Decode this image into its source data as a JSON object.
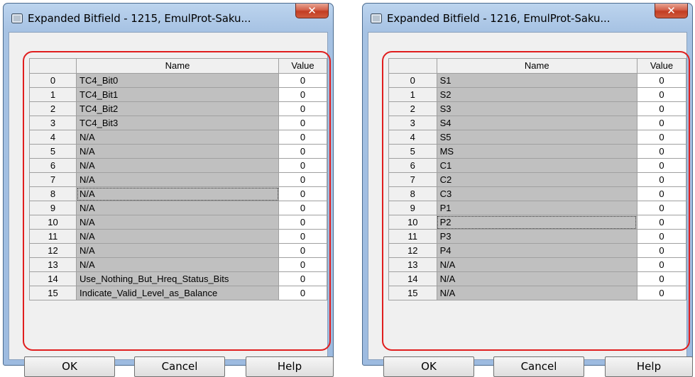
{
  "dialogs": [
    {
      "title": "Expanded Bitfield - 1215, EmulProt-Saku...",
      "columns": {
        "name": "Name",
        "value": "Value"
      },
      "rows": [
        {
          "idx": "0",
          "name": "TC4_Bit0",
          "value": "0"
        },
        {
          "idx": "1",
          "name": "TC4_Bit1",
          "value": "0"
        },
        {
          "idx": "2",
          "name": "TC4_Bit2",
          "value": "0"
        },
        {
          "idx": "3",
          "name": "TC4_Bit3",
          "value": "0"
        },
        {
          "idx": "4",
          "name": "N/A",
          "value": "0"
        },
        {
          "idx": "5",
          "name": "N/A",
          "value": "0"
        },
        {
          "idx": "6",
          "name": "N/A",
          "value": "0"
        },
        {
          "idx": "7",
          "name": "N/A",
          "value": "0"
        },
        {
          "idx": "8",
          "name": "N/A",
          "value": "0"
        },
        {
          "idx": "9",
          "name": "N/A",
          "value": "0"
        },
        {
          "idx": "10",
          "name": "N/A",
          "value": "0"
        },
        {
          "idx": "11",
          "name": "N/A",
          "value": "0"
        },
        {
          "idx": "12",
          "name": "N/A",
          "value": "0"
        },
        {
          "idx": "13",
          "name": "N/A",
          "value": "0"
        },
        {
          "idx": "14",
          "name": "Use_Nothing_But_Hreq_Status_Bits",
          "value": "0"
        },
        {
          "idx": "15",
          "name": "Indicate_Valid_Level_as_Balance",
          "value": "0"
        }
      ],
      "focused_row": 8,
      "buttons": {
        "ok": "OK",
        "cancel": "Cancel",
        "help": "Help"
      }
    },
    {
      "title": "Expanded Bitfield - 1216, EmulProt-Saku...",
      "columns": {
        "name": "Name",
        "value": "Value"
      },
      "rows": [
        {
          "idx": "0",
          "name": "S1",
          "value": "0"
        },
        {
          "idx": "1",
          "name": "S2",
          "value": "0"
        },
        {
          "idx": "2",
          "name": "S3",
          "value": "0"
        },
        {
          "idx": "3",
          "name": "S4",
          "value": "0"
        },
        {
          "idx": "4",
          "name": "S5",
          "value": "0"
        },
        {
          "idx": "5",
          "name": "MS",
          "value": "0"
        },
        {
          "idx": "6",
          "name": "C1",
          "value": "0"
        },
        {
          "idx": "7",
          "name": "C2",
          "value": "0"
        },
        {
          "idx": "8",
          "name": "C3",
          "value": "0"
        },
        {
          "idx": "9",
          "name": "P1",
          "value": "0"
        },
        {
          "idx": "10",
          "name": "P2",
          "value": "0"
        },
        {
          "idx": "11",
          "name": "P3",
          "value": "0"
        },
        {
          "idx": "12",
          "name": "P4",
          "value": "0"
        },
        {
          "idx": "13",
          "name": "N/A",
          "value": "0"
        },
        {
          "idx": "14",
          "name": "N/A",
          "value": "0"
        },
        {
          "idx": "15",
          "name": "N/A",
          "value": "0"
        }
      ],
      "focused_row": 10,
      "buttons": {
        "ok": "OK",
        "cancel": "Cancel",
        "help": "Help"
      }
    }
  ],
  "icons": {
    "window": "window-icon",
    "close": "close-icon"
  },
  "colors": {
    "highlight_outline": "#e01e1e",
    "name_cell_bg": "#c0c0c0",
    "close_button": "#c23d23"
  }
}
